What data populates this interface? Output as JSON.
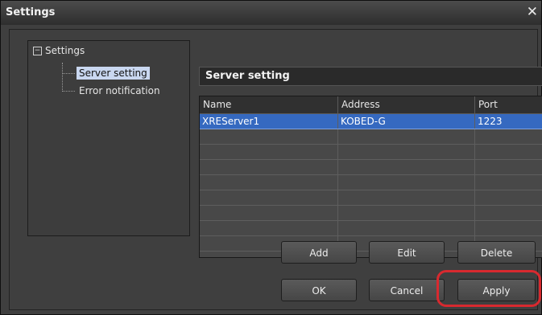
{
  "window": {
    "title": "Settings",
    "close_glyph": "✕",
    "close_icon": "close-icon"
  },
  "tree": {
    "toggle_glyph": "−",
    "root": "Settings",
    "children": [
      {
        "label": "Server setting",
        "selected": true
      },
      {
        "label": "Error notification",
        "selected": false
      }
    ]
  },
  "panel": {
    "section_title": "Server setting",
    "columns": [
      "Name",
      "Address",
      "Port"
    ],
    "rows": [
      {
        "name": "XREServer1",
        "address": "KOBED-G",
        "port": "1223",
        "selected": true
      }
    ],
    "empty_rows": 8
  },
  "buttons": {
    "add": "Add",
    "edit": "Edit",
    "delete": "Delete",
    "ok": "OK",
    "cancel": "Cancel",
    "apply": "Apply"
  },
  "colors": {
    "accent_selection": "#3569c0",
    "highlight_ring": "#d8292f",
    "tree_selection": "#c9d7f0"
  }
}
